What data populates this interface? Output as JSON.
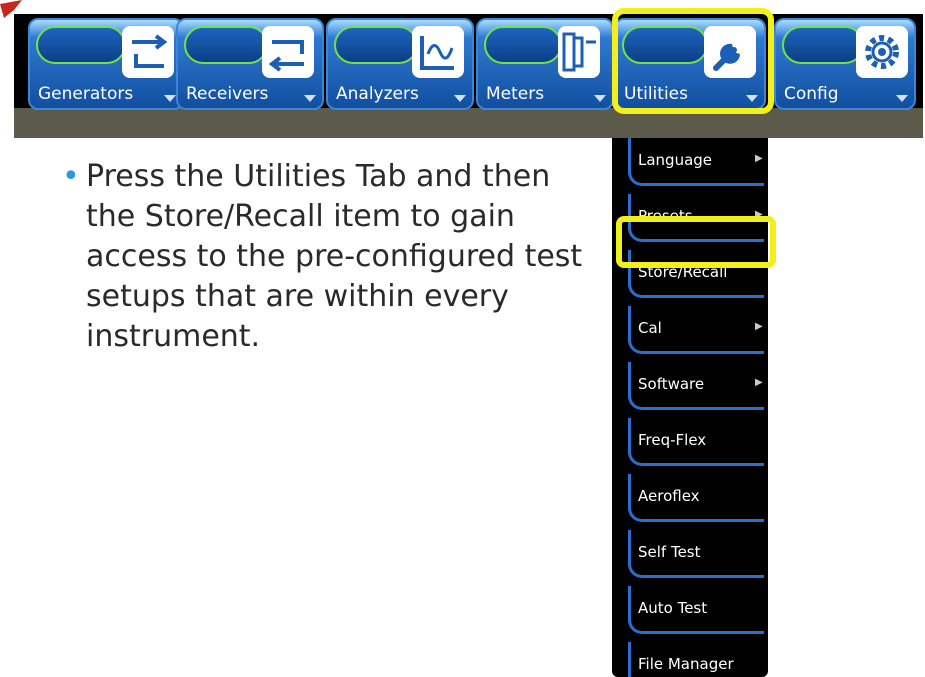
{
  "toolbar": {
    "tabs": [
      {
        "label": "Generators",
        "icon": "swap-arrows-icon",
        "selected": false
      },
      {
        "label": "Receivers",
        "icon": "swap-arrows-icon",
        "selected": false
      },
      {
        "label": "Analyzers",
        "icon": "waveform-icon",
        "selected": false
      },
      {
        "label": "Meters",
        "icon": "meter-icon",
        "selected": false
      },
      {
        "label": "Utilities",
        "icon": "wrench-icon",
        "selected": true
      },
      {
        "label": "Config",
        "icon": "gear-icon",
        "selected": false
      }
    ]
  },
  "menu": {
    "items": [
      {
        "label": "Language",
        "submenu": true
      },
      {
        "label": "Presets",
        "submenu": true
      },
      {
        "label": "Store/Recall",
        "submenu": false,
        "highlighted": true
      },
      {
        "label": "Cal",
        "submenu": true
      },
      {
        "label": "Software",
        "submenu": true
      },
      {
        "label": "Freq-Flex",
        "submenu": false
      },
      {
        "label": "Aeroflex",
        "submenu": false
      },
      {
        "label": "Self Test",
        "submenu": false
      },
      {
        "label": "Auto Test",
        "submenu": false
      },
      {
        "label": "File Manager",
        "submenu": false
      }
    ]
  },
  "instruction": {
    "bullet": "•",
    "text": "Press the Utilities Tab and then the Store/Recall item to gain access to the pre-configured test setups that are within every instrument."
  },
  "colors": {
    "highlight": "#f2ef1a",
    "tab_blue": "#1c65c0",
    "tab_green_outline": "#73e246",
    "menu_bg": "#000000",
    "bullet": "#2b9ad8"
  }
}
